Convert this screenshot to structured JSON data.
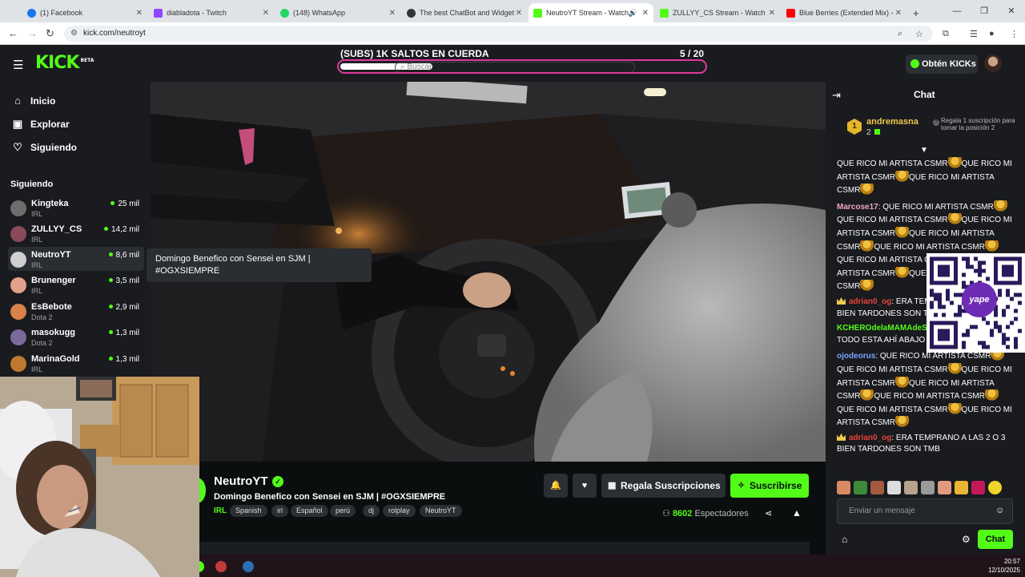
{
  "browser": {
    "tabs": [
      {
        "label": "(1) Facebook",
        "color": "#1877f2"
      },
      {
        "label": "diabladota - Twitch",
        "color": "#9146ff"
      },
      {
        "label": "(148) WhatsApp",
        "color": "#25d366"
      },
      {
        "label": "The best ChatBot and Widgets",
        "color": "#333333"
      },
      {
        "label": "NeutroYT Stream - Watch l",
        "color": "#53fc18"
      },
      {
        "label": "ZULLYY_CS Stream - Watch Liv",
        "color": "#53fc18"
      },
      {
        "label": "Blue Berries (Extended Mix) - Y",
        "color": "#ff0000"
      }
    ],
    "active_tab": 4,
    "url": "kick.com/neutroyt"
  },
  "header": {
    "logo": "KICK",
    "logo_sup": "BETA",
    "goal_title": "(SUBS) 1K SALTOS EN CUERDA",
    "goal_count": "5  / 20",
    "goal_progress": 0.25,
    "search_placeholder": "Buscar",
    "get_kicks": "Obtén KICKs"
  },
  "sidebar": {
    "nav": [
      {
        "label": "Inicio",
        "icon": "home-icon"
      },
      {
        "label": "Explorar",
        "icon": "browse-icon"
      },
      {
        "label": "Siguiendo",
        "icon": "heart-icon"
      }
    ],
    "following_title": "Siguiendo",
    "channels": [
      {
        "name": "Kingteka",
        "category": "IRL",
        "viewers": "25 mil",
        "color": "#6d6d6d"
      },
      {
        "name": "ZULLYY_CS",
        "category": "IRL",
        "viewers": "14,2 mil",
        "color": "#8a4a5a"
      },
      {
        "name": "NeutroYT",
        "category": "IRL",
        "viewers": "8,6 mil",
        "color": "#cfcfcf"
      },
      {
        "name": "Brunenger",
        "category": "IRL",
        "viewers": "3,5 mil",
        "color": "#e2a08a"
      },
      {
        "name": "EsBebote",
        "category": "Dota 2",
        "viewers": "2,9 mil",
        "color": "#d9824a"
      },
      {
        "name": "masokugg",
        "category": "Dota 2",
        "viewers": "1,3 mil",
        "color": "#7a6a9a"
      },
      {
        "name": "MarinaGold",
        "category": "IRL",
        "viewers": "1,3 mil",
        "color": "#c0782f"
      }
    ],
    "tooltip": "Domingo Benefico con Sensei en SJM | #OGXSIEMPRE"
  },
  "stream": {
    "streamer": "NeutroYT",
    "title": "Domingo Benefico con Sensei en SJM | #OGXSIEMPRE",
    "category": "IRL",
    "tags": [
      "Spanish",
      "irl",
      "Español",
      "perú",
      "dj",
      "rolplay",
      "NeutroYT"
    ],
    "gift_label": "Regala Suscripciones",
    "subscribe_label": "Suscribirse",
    "viewers": "8602",
    "viewers_label": "Espectadores"
  },
  "chat": {
    "title": "Chat",
    "top_gifter": "andremasna",
    "top_gifter_rank": "1",
    "top_gifter_count": "2",
    "gift_hint": "Regala 1 suscripción para tomar la posición 2",
    "input_placeholder": "Enviar un mensaje",
    "send_label": "Chat",
    "qr_label": "yape",
    "messages": [
      {
        "user": "",
        "color": "#ffffff",
        "crown": false,
        "parts": [
          "QUE RICO MI ARTISTA CSMR",
          "QUE RICO MI ARTISTA CSMR",
          "QUE RICO MI ARTISTA CSMR"
        ]
      },
      {
        "user": "Marcose17",
        "color": "#f2a6c8",
        "crown": false,
        "parts": [
          "QUE RICO MI ARTISTA CSMR",
          "QUE RICO MI ARTISTA CSMR",
          "QUE RICO MI ARTISTA CSMR",
          "QUE RICO MI ARTISTA CSMR",
          "QUE RICO MI ARTISTA CSMR",
          "QUE RICO MI ARTISTA CSMR",
          "QUE RICO MI ARTISTA CSMR",
          "QUE RICO MI ARTISTA CSMR"
        ]
      },
      {
        "user": "adrian0_og",
        "color": "#e8443a",
        "crown": true,
        "parts": [
          "ERA TEMPRANO A LAS 2 O 3 BIEN TARDONES SON TMB"
        ]
      },
      {
        "user": "KCHEROdelaMAMAdeS",
        "color": "#53fc18",
        "crown": false,
        "parts": [
          "ANDA MAS ARRIBA TODO ESTA AHÍ ABAJO ESTAN"
        ]
      },
      {
        "user": "ojodeorus",
        "color": "#7aa6ff",
        "crown": false,
        "parts": [
          "QUE RICO MI ARTISTA CSMR",
          "QUE RICO MI ARTISTA CSMR",
          "QUE RICO MI ARTISTA CSMR",
          "QUE RICO MI ARTISTA CSMR",
          "QUE RICO MI ARTISTA CSMR",
          "QUE RICO MI ARTISTA CSMR",
          "QUE RICO MI ARTISTA CSMR"
        ]
      },
      {
        "user": "adrian0_og",
        "color": "#e8443a",
        "crown": true,
        "parts": [
          "ERA TEMPRANO A LAS 2 O 3 BIEN TARDONES SON TMB"
        ]
      }
    ]
  },
  "taskbar": {
    "time": "20:57",
    "date": "12/10/2025"
  }
}
